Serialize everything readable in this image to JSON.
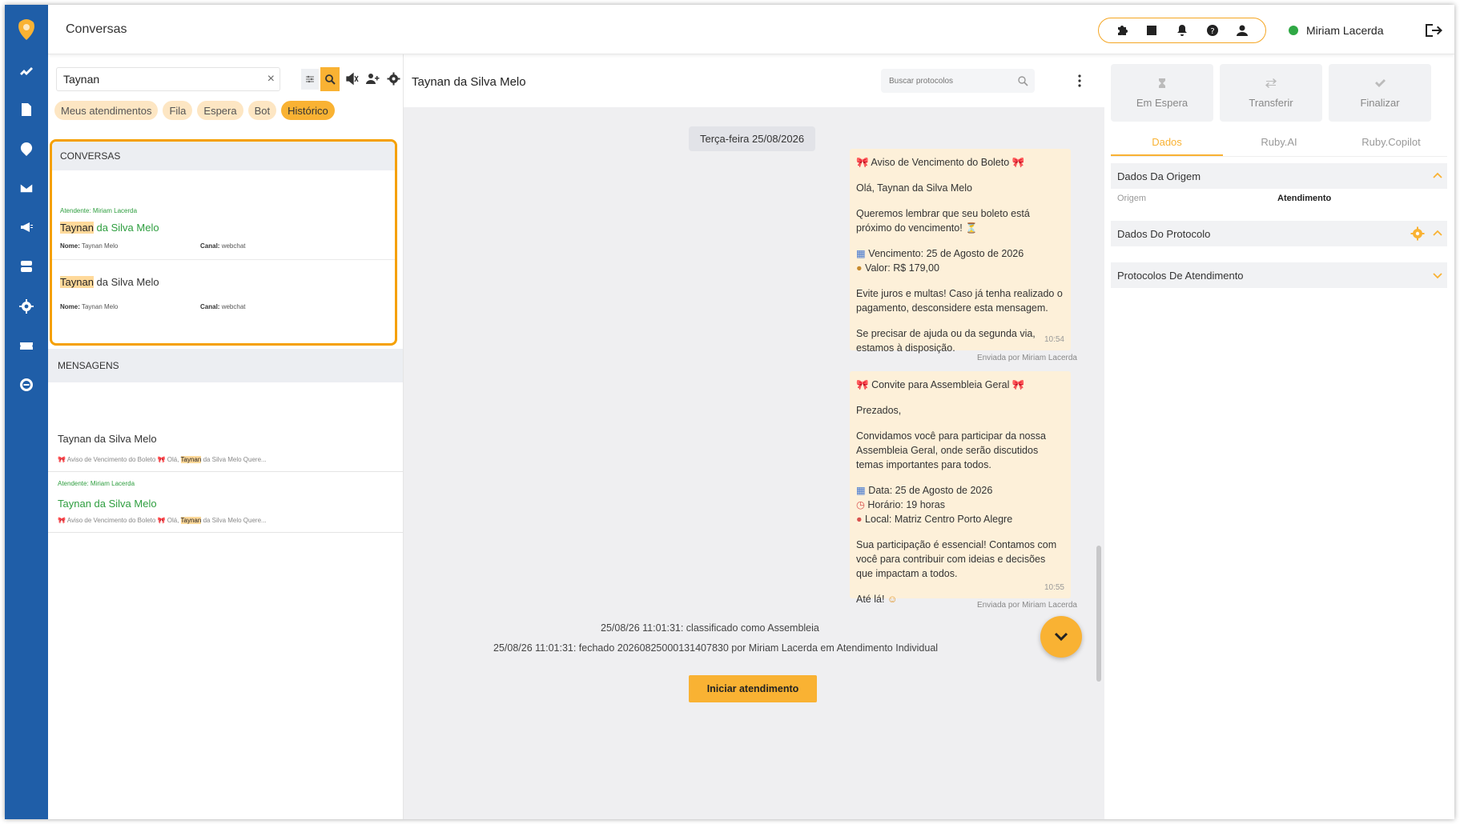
{
  "app": {
    "title": "Conversas"
  },
  "user": {
    "name": "Miriam Lacerda",
    "status_color": "#2fa844"
  },
  "colors": {
    "accent": "#f9b233",
    "rail": "#1f5ea8",
    "highlight": "#ffd99a",
    "green_text": "#2e9e3f"
  },
  "rail": {
    "items": [
      "logo-icon",
      "dashboard-icon",
      "documents-icon",
      "chat-icon",
      "mail-icon",
      "campaign-icon",
      "contacts-icon",
      "settings-icon",
      "tickets-icon",
      "api-icon"
    ]
  },
  "topbar": {
    "tools": [
      "extensions-icon",
      "inbox-icon",
      "bell-icon",
      "help-icon",
      "user-icon"
    ]
  },
  "search": {
    "value": "Taynan",
    "clear": "×"
  },
  "filters": {
    "chips": [
      "Meus atendimentos",
      "Fila",
      "Espera",
      "Bot",
      "Histórico"
    ],
    "active": "Histórico"
  },
  "conversations": {
    "heading": "CONVERSAS",
    "items": [
      {
        "attendant": "Atendente: Miriam Lacerda",
        "name_hl": "Taynan",
        "name_rest": " da Silva Melo",
        "nome_label": "Nome:",
        "nome_value": "Taynan Melo",
        "canal_label": "Canal:",
        "canal_value": "webchat"
      },
      {
        "name_hl": "Taynan",
        "name_rest": " da Silva Melo",
        "nome_label": "Nome:",
        "nome_value": "Taynan Melo",
        "canal_label": "Canal:",
        "canal_value": "webchat"
      }
    ]
  },
  "messages": {
    "heading": "MENSAGENS",
    "items": [
      {
        "name": "Taynan da Silva Melo",
        "preview_a": "Aviso de Vencimento do Boleto",
        "preview_b": "Olá,",
        "preview_hl": "Taynan",
        "preview_c": "da Silva Melo Quere..."
      },
      {
        "attendant": "Atendente: Miriam Lacerda",
        "name": "Taynan da Silva Melo",
        "preview_a": "Aviso de Vencimento do Boleto",
        "preview_b": "Olá,",
        "preview_hl": "Taynan",
        "preview_c": "da Silva Melo Quere..."
      }
    ]
  },
  "chat": {
    "title": "Taynan da Silva Melo",
    "protocol_search_placeholder": "Buscar protocolos",
    "date": "Terça-feira 25/08/2026",
    "bubble1": {
      "title": "Aviso de Vencimento do Boleto",
      "greeting": "Olá, Taynan da Silva Melo",
      "p1": "Queremos lembrar que seu boleto está próximo do vencimento! ⏳",
      "venc": "Vencimento: 25 de Agosto de 2026",
      "valor": "Valor: R$ 179,00",
      "p3": "Evite juros e multas! Caso já tenha realizado o pagamento, desconsidere esta mensagem.",
      "p4": "Se precisar de ajuda ou da segunda via, estamos à disposição.",
      "time": "10:54",
      "sent_by": "Enviada por Miriam Lacerda"
    },
    "bubble2": {
      "title": "Convite para Assembleia Geral",
      "greeting": "Prezados,",
      "p1": "Convidamos você para participar da nossa Assembleia Geral, onde serão discutidos temas importantes para todos.",
      "data": "Data: 25 de Agosto de 2026",
      "horario": "Horário: 19 horas",
      "local": "Local: Matriz Centro Porto Alegre",
      "p3": "Sua participação é essencial! Contamos com você para contribuir com ideias e decisões que impactam a todos.",
      "p4": "Até lá!",
      "time": "10:55",
      "sent_by": "Enviada por Miriam Lacerda"
    },
    "system": [
      "25/08/26 11:01:31: classificado como Assembleia",
      "25/08/26 11:01:31: fechado 20260825000131407830 por Miriam Lacerda em Atendimento Individual"
    ],
    "start_button": "Iniciar atendimento"
  },
  "right": {
    "actions": [
      "Em Espera",
      "Transferir",
      "Finalizar"
    ],
    "tabs": [
      "Dados",
      "Ruby.AI",
      "Ruby.Copilot"
    ],
    "active_tab": "Dados",
    "sections": {
      "origem_title": "Dados Da Origem",
      "origem_label": "Origem",
      "origem_value": "Atendimento",
      "protocolo_title": "Dados Do Protocolo",
      "protocolos_title": "Protocolos De Atendimento"
    }
  }
}
